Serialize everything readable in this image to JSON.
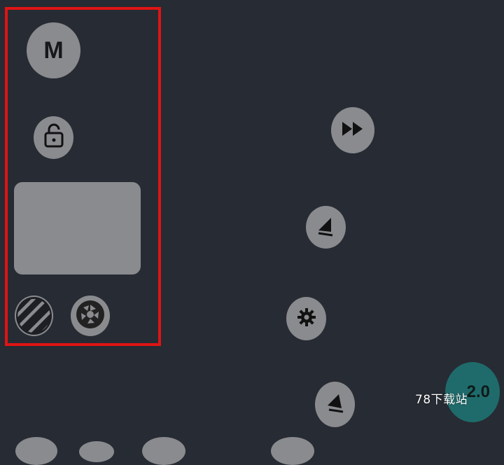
{
  "toolbar": {
    "mode_label": "M",
    "lock_state": "unlocked"
  },
  "controls": {
    "speed_value": "2.0"
  },
  "watermark": {
    "text": "78下载站"
  },
  "icons": {
    "mode": "m-letter-icon",
    "lock": "unlock-icon",
    "stripes": "striped-circle-icon",
    "aperture": "aperture-icon",
    "fast_forward": "fast-forward-icon",
    "nav_up_left": "triangle-left-icon",
    "settings": "gear-icon",
    "nav_left": "triangle-left-icon"
  },
  "colors": {
    "background": "#272b33",
    "button": "#8a8b8f",
    "highlight": "#e01414",
    "speed_badge": "#1f6b6b"
  }
}
